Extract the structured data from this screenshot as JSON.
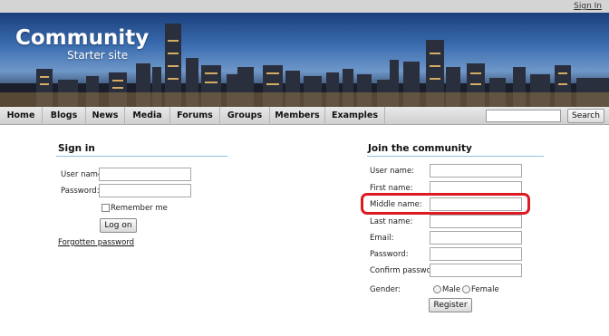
{
  "topbar": {
    "signin_label": "Sign In"
  },
  "brand": {
    "title": "Community",
    "subtitle": "Starter site"
  },
  "nav": {
    "items": [
      "Home",
      "Blogs",
      "News",
      "Media",
      "Forums",
      "Groups",
      "Members",
      "Examples"
    ],
    "search_button": "Search",
    "search_value": ""
  },
  "signin": {
    "title": "Sign in",
    "username_label": "User name:",
    "password_label": "Password:",
    "remember_label": "Remember me",
    "logon_button": "Log on",
    "forgot_link": "Forgotten password"
  },
  "join": {
    "title": "Join the community",
    "fields": [
      "User name:",
      "First name:",
      "Middle name:",
      "Last name:",
      "Email:",
      "Password:",
      "Confirm password:"
    ],
    "gender_label": "Gender:",
    "male_label": "Male",
    "female_label": "Female",
    "register_button": "Register"
  },
  "colors": {
    "highlight": "#dd1a22",
    "section_rule": "#8cc0e4"
  }
}
